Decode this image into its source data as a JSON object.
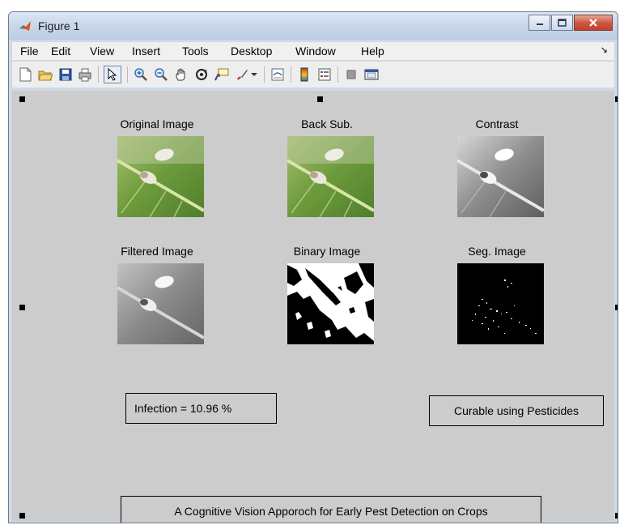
{
  "window": {
    "title": "Figure 1"
  },
  "menubar": {
    "items": [
      "File",
      "Edit",
      "View",
      "Insert",
      "Tools",
      "Desktop",
      "Window",
      "Help"
    ]
  },
  "toolbar": {
    "icons": [
      "new-figure-icon",
      "open-file-icon",
      "save-icon",
      "print-icon",
      "pointer-icon",
      "zoom-in-icon",
      "zoom-out-icon",
      "pan-icon",
      "rotate-3d-icon",
      "data-cursor-icon",
      "brush-icon",
      "link-plot-icon",
      "colorbar-icon",
      "legend-icon",
      "hide-plot-tools-icon",
      "show-plot-tools-icon"
    ]
  },
  "figure": {
    "images": [
      {
        "title": "Original Image"
      },
      {
        "title": "Back Sub."
      },
      {
        "title": "Contrast"
      },
      {
        "title": "Filtered Image"
      },
      {
        "title": "Binary Image"
      },
      {
        "title": "Seg. Image"
      }
    ],
    "infection_text": "Infection = 10.96 %",
    "recommendation_text": "Curable using Pesticides",
    "caption": "A Cognitive Vision Apporoch for Early Pest Detection on Crops"
  },
  "colors": {
    "figure_background": "#cccccc",
    "titlebar": "#c7d5e8",
    "close_button": "#c7503a"
  }
}
